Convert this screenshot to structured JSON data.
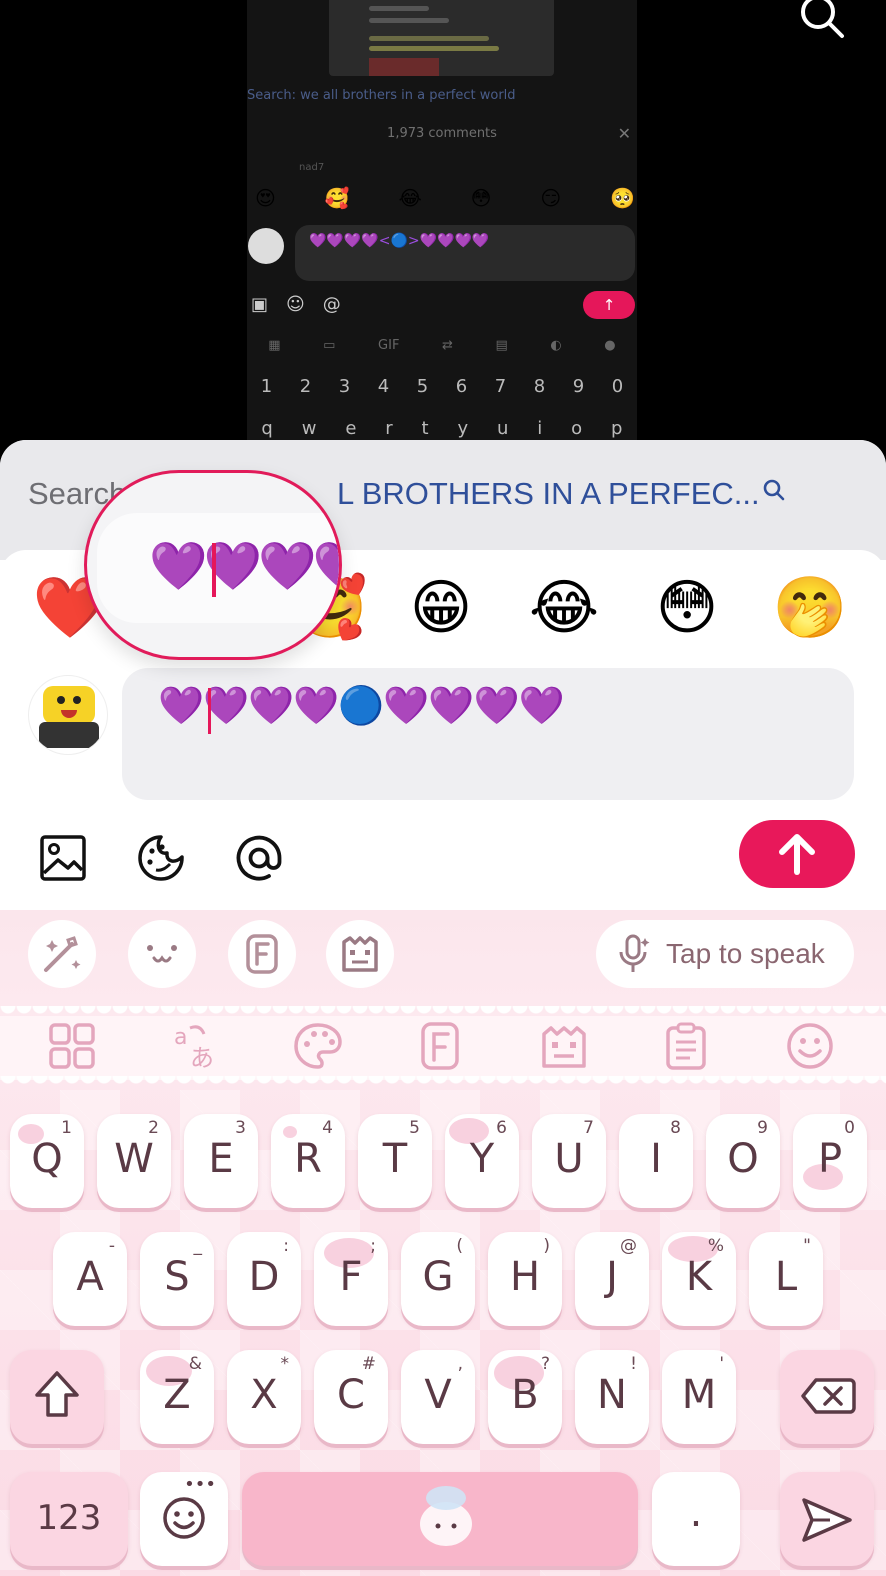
{
  "background": {
    "inner_search": "Search: we all brothers in a perfect world",
    "inner_comment_count": "1,973 comments",
    "inner_username": "nad7",
    "inner_emojis": [
      "😍",
      "🥰",
      "😂",
      "😳",
      "😏",
      "🥺"
    ],
    "inner_input": "💜💜💜💜<🔵>💜💜💜💜",
    "inner_tool_icons": [
      "image-icon",
      "sticker-icon",
      "at-icon"
    ],
    "inner_keyboard_tools": [
      "apps-icon",
      "media-icon",
      "GIF",
      "translate-icon",
      "clipboard-icon",
      "palette-icon",
      "mic-icon"
    ],
    "inner_number_row": [
      "1",
      "2",
      "3",
      "4",
      "5",
      "6",
      "7",
      "8",
      "9",
      "0"
    ],
    "inner_letter_row": [
      "q",
      "w",
      "e",
      "r",
      "t",
      "y",
      "u",
      "i",
      "o",
      "p"
    ]
  },
  "search": {
    "label": "Search",
    "query": "L BROTHERS IN A PERFEC..."
  },
  "emoji_bar": [
    "❤️",
    "🥰",
    "😁",
    "😂",
    "😳",
    "🤭"
  ],
  "comment_input": {
    "value": "💜💜💜💜🔵💜💜💜💜"
  },
  "magnifier": {
    "text": "💜💜💜💜"
  },
  "compose_tools": [
    "image-icon",
    "sticker-icon",
    "at-icon"
  ],
  "colors": {
    "accent": "#e8185a",
    "search_query": "#2f4f9a",
    "emoji_purple": "#a24be0",
    "keyboard_bg": "#fbe6ec",
    "key_text": "#5a3a45"
  },
  "keyboard": {
    "top_tools": [
      "magic-wand-icon",
      "kaomoji-icon",
      "font-icon",
      "theme-icon"
    ],
    "tap_to_speak": "Tap to speak",
    "toolbar": [
      "apps-icon",
      "translate-icon",
      "palette-icon",
      "font-icon",
      "theme-icon",
      "clipboard-icon",
      "emoji-icon"
    ],
    "row1": [
      {
        "letter": "Q",
        "sup": "1"
      },
      {
        "letter": "W",
        "sup": "2"
      },
      {
        "letter": "E",
        "sup": "3"
      },
      {
        "letter": "R",
        "sup": "4"
      },
      {
        "letter": "T",
        "sup": "5"
      },
      {
        "letter": "Y",
        "sup": "6"
      },
      {
        "letter": "U",
        "sup": "7"
      },
      {
        "letter": "I",
        "sup": "8"
      },
      {
        "letter": "O",
        "sup": "9"
      },
      {
        "letter": "P",
        "sup": "0"
      }
    ],
    "row2": [
      {
        "letter": "A",
        "sup": "-"
      },
      {
        "letter": "S",
        "sup": "_"
      },
      {
        "letter": "D",
        "sup": ":"
      },
      {
        "letter": "F",
        "sup": ";"
      },
      {
        "letter": "G",
        "sup": "("
      },
      {
        "letter": "H",
        "sup": ")"
      },
      {
        "letter": "J",
        "sup": "@"
      },
      {
        "letter": "K",
        "sup": "%"
      },
      {
        "letter": "L",
        "sup": "\""
      }
    ],
    "row3": [
      {
        "letter": "Z",
        "sup": "&"
      },
      {
        "letter": "X",
        "sup": "*"
      },
      {
        "letter": "C",
        "sup": "#"
      },
      {
        "letter": "V",
        "sup": ","
      },
      {
        "letter": "B",
        "sup": "?"
      },
      {
        "letter": "N",
        "sup": "!"
      },
      {
        "letter": "M",
        "sup": "'"
      }
    ],
    "numbers_key": "123",
    "period_key": "."
  }
}
